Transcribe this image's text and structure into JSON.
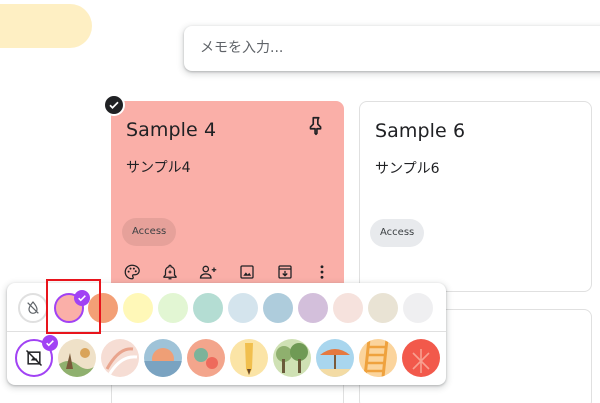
{
  "take_note": {
    "placeholder": "メモを入力..."
  },
  "notes": [
    {
      "title": "Sample 4",
      "body": "サンプル4",
      "label": "Access",
      "color": "#faafa8",
      "pinned": true,
      "selected": true
    },
    {
      "title": "Sample 6",
      "body": "サンプル6",
      "label": "Access",
      "color": "#ffffff"
    }
  ],
  "card_toolbar": {
    "icons": [
      "palette-icon",
      "reminder-icon",
      "collaborator-icon",
      "image-icon",
      "archive-icon",
      "more-icon"
    ]
  },
  "color_palette": {
    "selected": "#faafa8",
    "colors": [
      "none",
      "#faafa8",
      "#f39f76",
      "#fff8b8",
      "#e2f6d3",
      "#b4ddd3",
      "#d4e4ed",
      "#aeccdc",
      "#d3bfdb",
      "#f6e2dd",
      "#e9e3d4",
      "#efeff1"
    ],
    "backgrounds": [
      "none",
      "groceries",
      "food",
      "music",
      "recipes",
      "notes",
      "places",
      "travel",
      "video",
      "celebration"
    ],
    "selected_background": "none"
  }
}
